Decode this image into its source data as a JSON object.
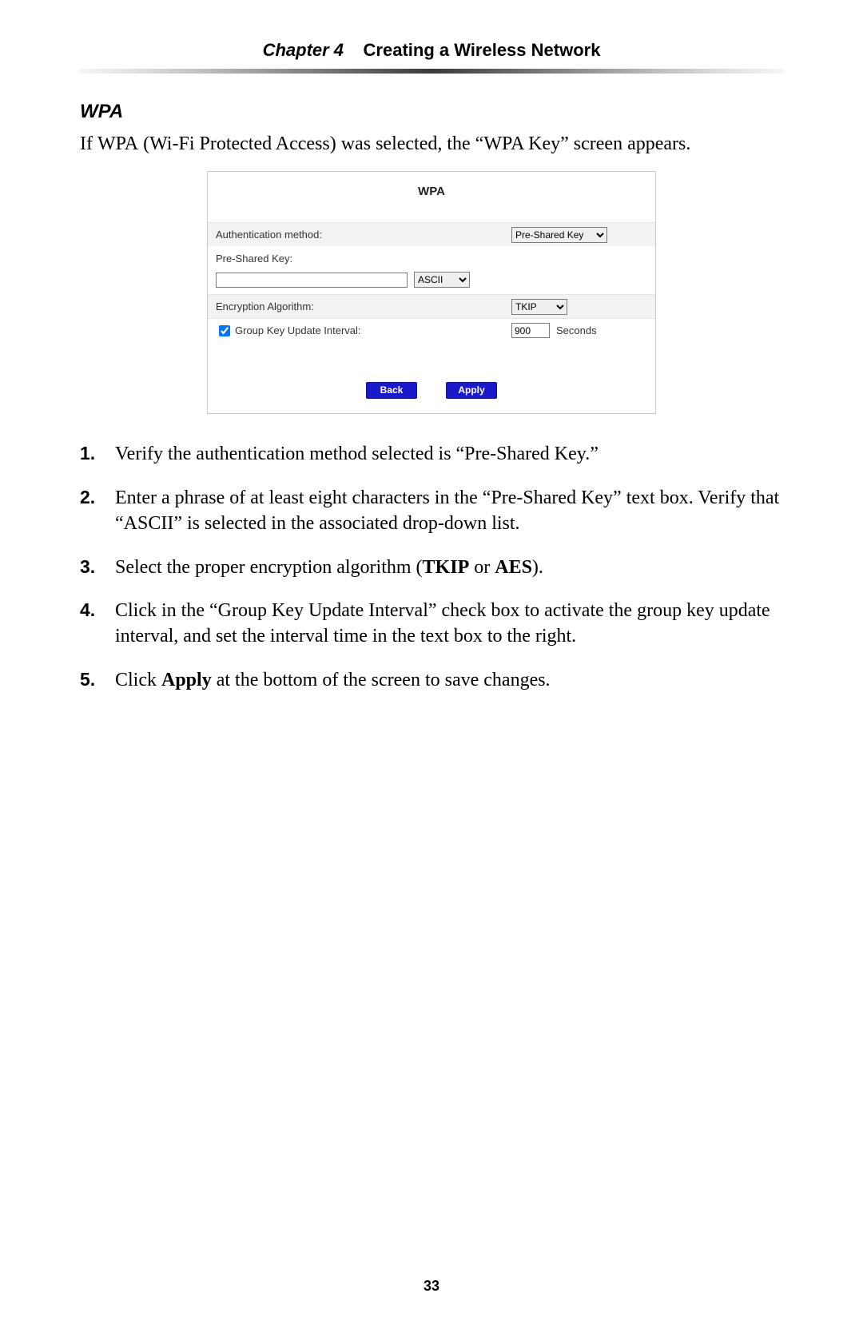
{
  "header": {
    "chapter_label": "Chapter 4",
    "chapter_title": "Creating a Wireless Network"
  },
  "section": {
    "title": "WPA",
    "intro_pre": "If ",
    "intro_acronym": "WPA",
    "intro_post": " (Wi-Fi Protected Access) was selected, the “WPA Key” screen appears."
  },
  "panel": {
    "title": "WPA",
    "auth_label": "Authentication method:",
    "auth_value": "Pre-Shared Key",
    "psk_label": "Pre-Shared Key:",
    "psk_value": "",
    "format_value": "ASCII",
    "enc_label": "Encryption Algorithm:",
    "enc_value": "TKIP",
    "gk_label": "Group Key Update Interval:",
    "gk_checked": true,
    "gk_value": "900",
    "gk_unit": "Seconds",
    "back_label": "Back",
    "apply_label": "Apply"
  },
  "steps": {
    "s1": {
      "num": "1.",
      "text": "Verify the authentication method selected is “Pre-Shared Key.”"
    },
    "s2": {
      "num": "2.",
      "a": "Enter a phrase of at least eight characters in the “Pre-Shared Key” text box. Verify that “",
      "ascii": "ASCII",
      "b": "” is selected in the associated drop-down list."
    },
    "s3": {
      "num": "3.",
      "a": "Select the proper encryption algorithm (",
      "tkip": "TKIP",
      "or": " or ",
      "aes": "AES",
      "b": ")."
    },
    "s4": {
      "num": "4.",
      "text": "Click in the “Group Key Update Interval” check box to activate the group key update interval, and set the interval time in the text box to the right."
    },
    "s5": {
      "num": "5.",
      "a": "Click ",
      "apply": "Apply",
      "b": " at the bottom of the screen to save changes."
    }
  },
  "page_number": "33"
}
